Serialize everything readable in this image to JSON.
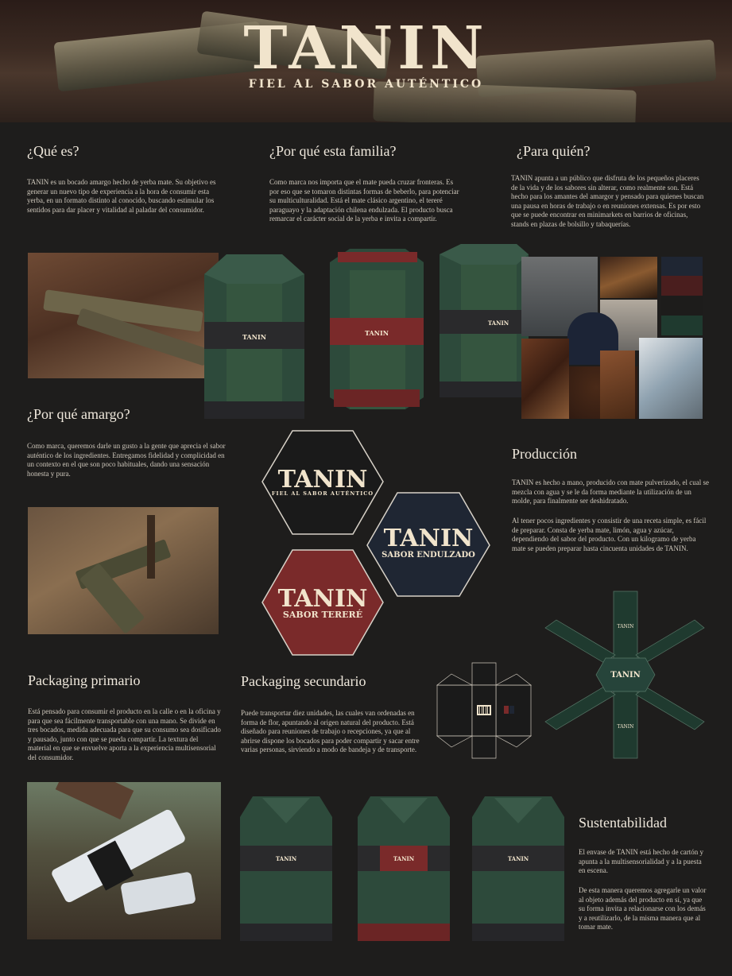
{
  "brand": {
    "name": "TANIN",
    "tagline": "FIEL AL SABOR AUTÉNTICO",
    "tagline_small": "FIEL AL SABOR AUTÉNTICO",
    "variant_endulzado": "SABOR ENDULZADO",
    "variant_terere": "SABOR TERERÉ"
  },
  "sections": {
    "que_es": {
      "title": "¿Qué es?",
      "body": "TANIN es un bocado amargo hecho de yerba mate. Su objetivo es generar un nuevo tipo de experiencia a la hora de consumir esta yerba, en un formato distinto al conocido, buscando estimular los sentidos para dar placer y vitalidad al paladar del consumidor."
    },
    "por_que_familia": {
      "title": "¿Por qué esta familia?",
      "body": "Como marca nos importa que el mate pueda cruzar fronteras. Es por eso que se tomaron distintas formas de beberlo, para potenciar su multiculturalidad. Está el mate clásico argentino, el tereré paraguayo y la adaptación chilena endulzada. El producto busca remarcar el carácter social de la yerba e invita a compartir."
    },
    "para_quien": {
      "title": "¿Para quién?",
      "body": "TANIN apunta a un público que disfruta de los pequeños placeres de la vida y de los sabores sin alterar, como realmente son. Está hecho para los amantes del amargor y pensado para quienes buscan una pausa en horas de trabajo o en reuniones extensas. Es por esto que se puede encontrar en minimarkets en barrios de oficinas, stands en plazas de bolsillo y tabaquerías."
    },
    "por_que_amargo": {
      "title": "¿Por qué amargo?",
      "body": "Como marca, queremos darle un gusto a la gente que aprecia el sabor auténtico de los ingredientes. Entregamos fidelidad y complicidad en un contexto en el que son poco habituales, dando una sensación honesta y pura."
    },
    "produccion": {
      "title": "Producción",
      "body1": "TANIN es hecho a mano, producido con mate pulverizado, el cual se mezcla con agua y se le da forma mediante la utilización de un molde, para finalmente ser deshidratado.",
      "body2": "Al tener pocos ingredientes y consistir de una receta simple, es fácil de preparar. Consta de yerba mate, limón, agua y azúcar, dependiendo del sabor del producto. Con un kilogramo de yerba mate se pueden preparar hasta cincuenta unidades de TANIN."
    },
    "packaging_primario": {
      "title": "Packaging primario",
      "body": "Está pensado para consumir el producto en la calle o en la oficina y para que sea fácilmente transportable con una mano. Se divide en tres bocados, medida adecuada para que su consumo sea dosificado y pausado, junto con que se pueda compartir. La textura del material en que se envuelve aporta a la experiencia multisensorial del consumidor."
    },
    "packaging_secundario": {
      "title": "Packaging secundario",
      "body": "Puede transportar diez unidades, las cuales van ordenadas en forma de flor, apuntando al origen natural del producto. Está diseñado para reuniones de trabajo o recepciones, ya que al abrirse dispone los bocados para poder compartir y sacar entre varias personas, sirviendo a modo de bandeja y de transporte."
    },
    "sustentabilidad": {
      "title": "Sustentabilidad",
      "body1": "El envase de TANIN está hecho de cartón y apunta a la multisensorialidad y a la puesta en escena.",
      "body2": "De esta manera queremos agregarle un valor al objeto además del producto en sí, ya que su forma invita a relacionarse con los demás y a reutilizarlo, de la misma manera que al tomar mate."
    }
  },
  "colors": {
    "background": "#1e1d1c",
    "green": "#2c4a3c",
    "dark_green": "#1f3a2f",
    "red": "#7a2a2a",
    "navy": "#1f2633",
    "cream": "#f1e4cc"
  },
  "icons": {
    "barcode": "barcode-icon"
  }
}
